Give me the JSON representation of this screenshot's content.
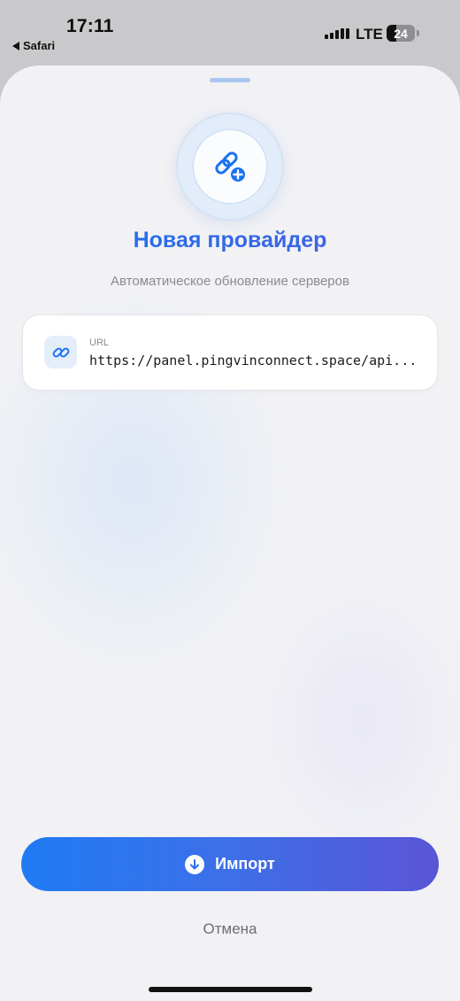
{
  "status_bar": {
    "time": "17:11",
    "back_app": "Safari",
    "carrier": "LTE",
    "battery": "24"
  },
  "sheet": {
    "title": "Новая провайдер",
    "subtitle": "Автоматическое обновление серверов",
    "url_field": {
      "label": "URL",
      "value": "https://panel.pingvinconnect.space/api..."
    },
    "import_label": "Импорт",
    "cancel_label": "Отмена"
  },
  "colors": {
    "accent": "#1a73f0",
    "accent_end": "#5a55d6",
    "sheet_bg": "#f2f2f5",
    "muted_text": "#8a8a90"
  },
  "icons": {
    "header": "link-plus-icon",
    "url": "link-icon",
    "import": "download-arrow-icon"
  }
}
